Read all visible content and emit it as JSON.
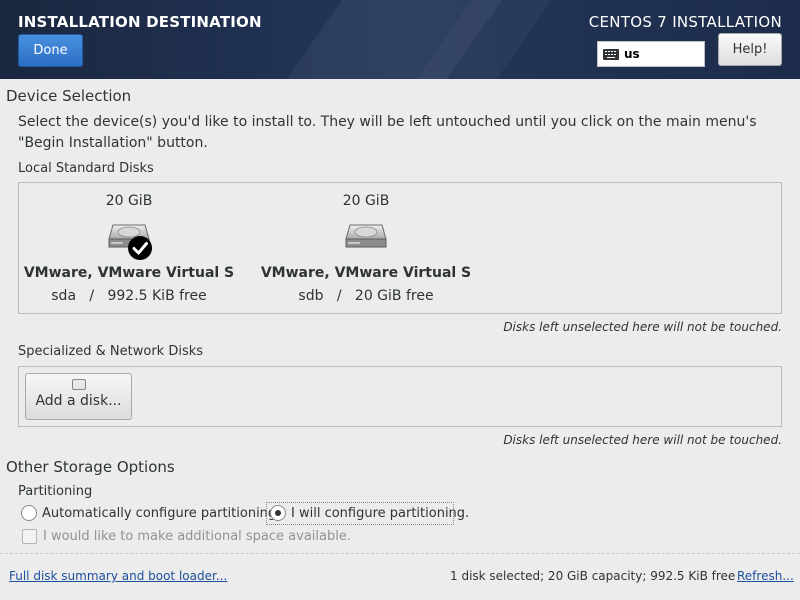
{
  "header": {
    "title": "INSTALLATION DESTINATION",
    "done_label": "Done",
    "product": "CENTOS 7 INSTALLATION",
    "keyboard_layout": "us",
    "help_label": "Help!"
  },
  "device_selection": {
    "heading": "Device Selection",
    "instruction_line1": "Select the device(s) you'd like to install to.  They will be left untouched until you click on the main menu's",
    "instruction_line2": "\"Begin Installation\" button.",
    "local_heading": "Local Standard Disks",
    "disks": [
      {
        "size": "20 GiB",
        "name": "VMware, VMware Virtual S",
        "device": "sda",
        "sep": "/",
        "free": "992.5 KiB free",
        "selected": true,
        "icon": "hard-disk-icon"
      },
      {
        "size": "20 GiB",
        "name": "VMware, VMware Virtual S",
        "device": "sdb",
        "sep": "/",
        "free": "20 GiB free",
        "selected": false,
        "icon": "hard-disk-icon"
      }
    ],
    "local_note": "Disks left unselected here will not be touched.",
    "special_heading": "Specialized & Network Disks",
    "add_disk_label": "Add a disk...",
    "special_note": "Disks left unselected here will not be touched."
  },
  "storage_options": {
    "heading": "Other Storage Options",
    "partitioning_heading": "Partitioning",
    "auto_label": "Automatically configure partitioning.",
    "manual_label": "I will configure partitioning.",
    "selected": "manual",
    "extra_space_label": "I would like to make additional space available."
  },
  "footer": {
    "summary_link": "Full disk summary and boot loader...",
    "status": "1 disk selected; 20 GiB capacity; 992.5 KiB free",
    "refresh_link": "Refresh..."
  },
  "colors": {
    "header_bg": "#1f2f4f",
    "done_blue": "#2a6fc4",
    "link": "#1c4f9c"
  }
}
